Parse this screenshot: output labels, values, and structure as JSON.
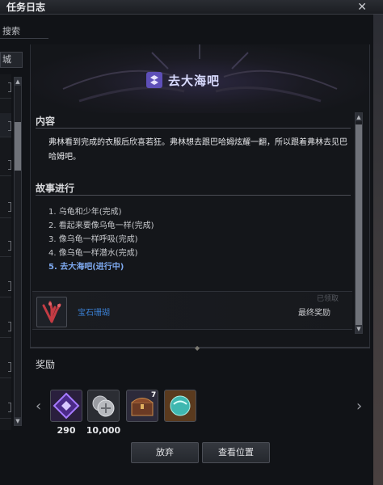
{
  "window": {
    "title": "任务日志",
    "close_icon": "close-icon"
  },
  "sidebar": {
    "search_tab": "搜索",
    "category": "城"
  },
  "quest": {
    "name": "去大海吧",
    "icon": "quest-rune-icon"
  },
  "content": {
    "heading": "内容",
    "description": "弗林看到完成的衣服后欣喜若狂。弗林想去跟巴哈姆炫耀一翻，所以跟着弗林去见巴哈姆吧。"
  },
  "story": {
    "heading": "故事进行",
    "steps": [
      {
        "label": "1. 乌龟和少年(完成)",
        "active": false
      },
      {
        "label": "2. 看起来要像乌龟一样(完成)",
        "active": false
      },
      {
        "label": "3. 像乌龟一样呼吸(完成)",
        "active": false
      },
      {
        "label": "4. 像乌龟一样潜水(完成)",
        "active": false
      },
      {
        "label": "5. 去大海吧(进行中)",
        "active": true
      }
    ]
  },
  "final_reward": {
    "item_name": "宝石珊瑚",
    "label": "最终奖励",
    "faint_text": "已领取",
    "icon": "coral-gem-icon"
  },
  "rewards": {
    "heading": "奖励",
    "items": [
      {
        "icon": "rune-crystal-icon",
        "count": "290"
      },
      {
        "icon": "silver-coins-icon",
        "count": "10,000"
      },
      {
        "icon": "treasure-chest-icon",
        "badge": "7"
      },
      {
        "icon": "cyan-orb-icon"
      }
    ],
    "prev_icon": "chevron-left-icon",
    "next_icon": "chevron-right-icon"
  },
  "buttons": {
    "abandon": "放弃",
    "view_location": "查看位置"
  },
  "colors": {
    "active_step": "#7da8ee",
    "link_item": "#3b7fd1",
    "quest_title": "#d9dbff"
  }
}
